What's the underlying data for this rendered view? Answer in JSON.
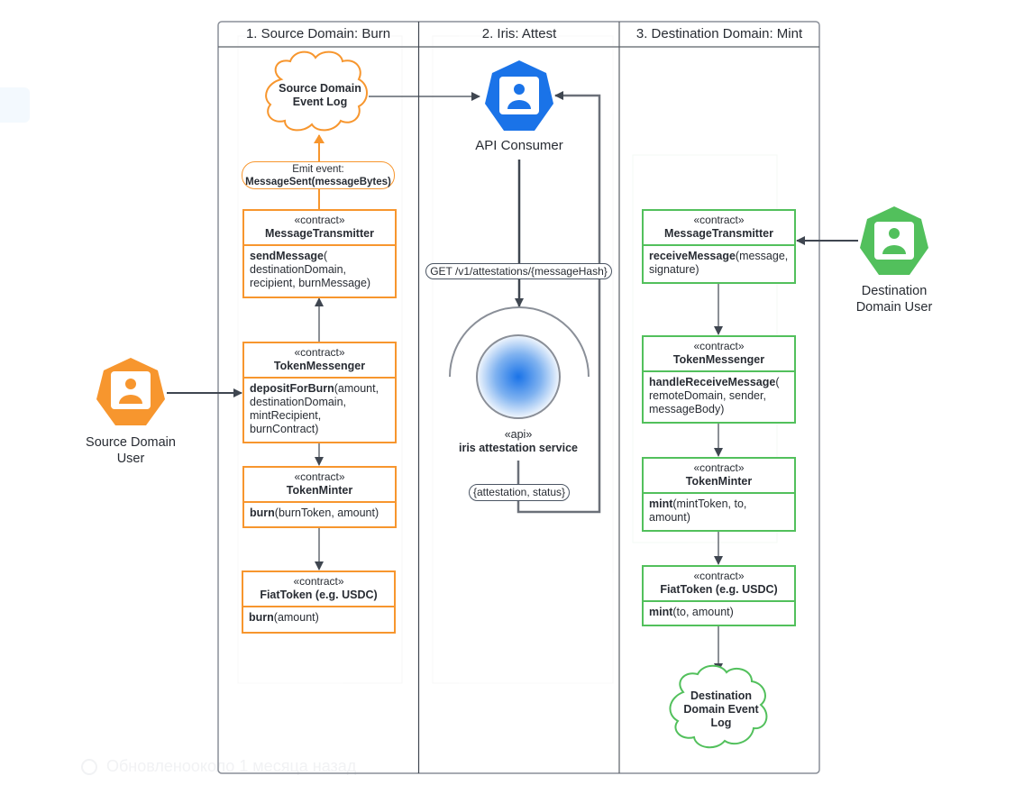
{
  "background_ghost": {
    "status_text": "Обновленооколо 1 месяца назад"
  },
  "lanes": [
    {
      "title": "1. Source Domain: Burn"
    },
    {
      "title": "2. Iris: Attest"
    },
    {
      "title": "3. Destination Domain: Mint"
    }
  ],
  "colors": {
    "source": "#f7962e",
    "destination": "#52c05c",
    "iris": "#1a73e8",
    "line": "#3f4650"
  },
  "source": {
    "actor": {
      "label_line1": "Source Domain",
      "label_line2": "User",
      "icon": "user-icon"
    },
    "event_log": {
      "line1": "Source Domain",
      "line2": "Event Log"
    },
    "emit_event": {
      "line1": "Emit event:",
      "line2": "MessageSent(messageBytes)"
    },
    "contracts": [
      {
        "stereotype": "«contract»",
        "name": "MessageTransmitter",
        "method": "sendMessage",
        "args": "(\ndestinationDomain,\nrecipient, burnMessage)"
      },
      {
        "stereotype": "«contract»",
        "name": "TokenMessenger",
        "method": "depositForBurn",
        "args": "(amount,\ndestinationDomain,\nmintRecipient,\nburnContract)"
      },
      {
        "stereotype": "«contract»",
        "name": "TokenMinter",
        "method": "burn",
        "args": "(burnToken, amount)"
      },
      {
        "stereotype": "«contract»",
        "name": "FiatToken (e.g. USDC)",
        "method": "burn",
        "args": "(amount)"
      }
    ]
  },
  "iris": {
    "consumer": {
      "label": "API Consumer",
      "icon": "user-icon"
    },
    "request_label": "GET /v1/attestations/{messageHash}",
    "service": {
      "stereotype": "«api»",
      "name": "iris attestation service"
    },
    "response_label": "{attestation, status}"
  },
  "destination": {
    "actor": {
      "label_line1": "Destination",
      "label_line2": "Domain User",
      "icon": "user-icon"
    },
    "contracts": [
      {
        "stereotype": "«contract»",
        "name": "MessageTransmitter",
        "method": "receiveMessage",
        "args": "(message,\nsignature)"
      },
      {
        "stereotype": "«contract»",
        "name": "TokenMessenger",
        "method": "handleReceiveMessage",
        "args": "(\nremoteDomain, sender,\nmessageBody)"
      },
      {
        "stereotype": "«contract»",
        "name": "TokenMinter",
        "method": "mint",
        "args": "(mintToken, to,\namount)"
      },
      {
        "stereotype": "«contract»",
        "name": "FiatToken (e.g. USDC)",
        "method": "mint",
        "args": "(to, amount)"
      }
    ],
    "event_log": {
      "line1": "Destination",
      "line2": "Domain Event",
      "line3": "Log"
    }
  }
}
